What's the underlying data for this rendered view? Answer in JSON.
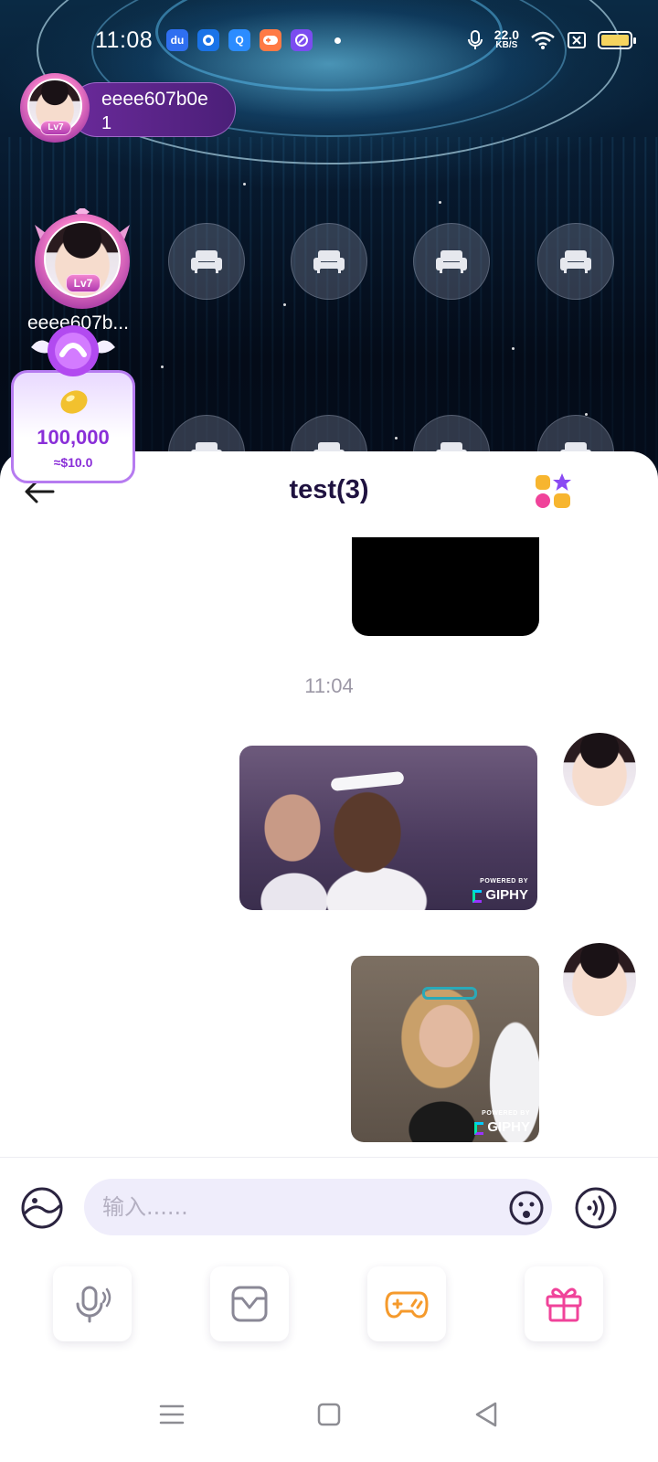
{
  "status_bar": {
    "time": "11:08",
    "net_speed_value": "22.0",
    "net_speed_unit": "KB/S",
    "notification_icons": [
      "baidu-icon",
      "blue-circle-app-icon",
      "q-browser-icon",
      "game-center-icon",
      "purple-app-icon"
    ]
  },
  "room": {
    "owner": {
      "name": "eeee607b0e",
      "count": "1",
      "level": "Lv7"
    },
    "host_seat": {
      "name": "eeee607b...",
      "level": "Lv7"
    },
    "empty_seat_icon": "sofa-icon"
  },
  "coin_box": {
    "amount": "100,000",
    "usd": "≈$10.0"
  },
  "chat": {
    "title": "test(3)",
    "time_separator": "11:04",
    "gif_watermark_pre": "POWERED BY",
    "gif_watermark": "GIPHY"
  },
  "input": {
    "placeholder": "输入......"
  },
  "colors": {
    "accent_purple": "#8a2fd8",
    "title_text": "#1f1240",
    "input_bg": "#efedfb",
    "game_orange": "#f59a2c",
    "gift_pink": "#f0439a"
  }
}
